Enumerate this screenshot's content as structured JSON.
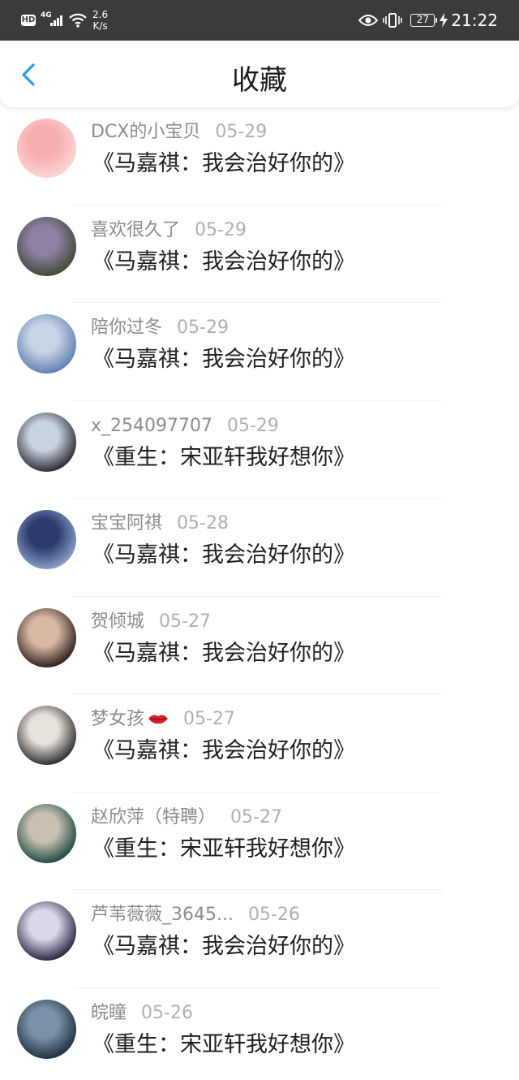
{
  "status_bar": {
    "hd_label": "HD",
    "network_label": "4G",
    "speed_value": "2.6",
    "speed_unit": "K/s",
    "battery_level": "27",
    "time": "21:22"
  },
  "header": {
    "title": "收藏",
    "back_icon": "chevron-left-icon",
    "accent_color": "#2a9ae8"
  },
  "favorites": [
    {
      "user": "DCX的小宝贝",
      "date": "05-29",
      "title": "《马嘉祺：我会治好你的》",
      "avatar_colors": [
        "#fbd5d5",
        "#f7aeb0"
      ]
    },
    {
      "user": "喜欢很久了",
      "date": "05-29",
      "title": "《马嘉祺：我会治好你的》",
      "avatar_colors": [
        "#3f4a35",
        "#8f7fa3"
      ]
    },
    {
      "user": "陪你过冬",
      "date": "05-29",
      "title": "《马嘉祺：我会治好你的》",
      "avatar_colors": [
        "#5f7fb0",
        "#c7d3e6"
      ]
    },
    {
      "user": "x_254097707",
      "date": "05-29",
      "title": "《重生：宋亚轩我好想你》",
      "avatar_colors": [
        "#2a2a33",
        "#c9d3e0"
      ]
    },
    {
      "user": "宝宝阿祺",
      "date": "05-28",
      "title": "《马嘉祺：我会治好你的》",
      "avatar_colors": [
        "#8aa0c8",
        "#2d3c6e"
      ]
    },
    {
      "user": "贺倾城",
      "date": "05-27",
      "title": "《马嘉祺：我会治好你的》",
      "avatar_colors": [
        "#2b1f1d",
        "#d9b8a3"
      ]
    },
    {
      "user": "梦女孩",
      "date": "05-27",
      "title": "《马嘉祺：我会治好你的》",
      "avatar_colors": [
        "#2e2b2b",
        "#e8e2dc"
      ]
    },
    {
      "user": "赵欣萍（特聘）",
      "date": "05-27",
      "title": "《重生：宋亚轩我好想你》",
      "avatar_colors": [
        "#1d4a44",
        "#c9c0b2"
      ]
    },
    {
      "user": "芦苇薇薇_3645...",
      "date": "05-26",
      "title": "《马嘉祺：我会治好你的》",
      "avatar_colors": [
        "#2a2440",
        "#d8d8e8"
      ]
    },
    {
      "user": "皖瞳",
      "date": "05-26",
      "title": "《重生：宋亚轩我好想你》",
      "avatar_colors": [
        "#1f2f40",
        "#7a92a8"
      ]
    }
  ]
}
